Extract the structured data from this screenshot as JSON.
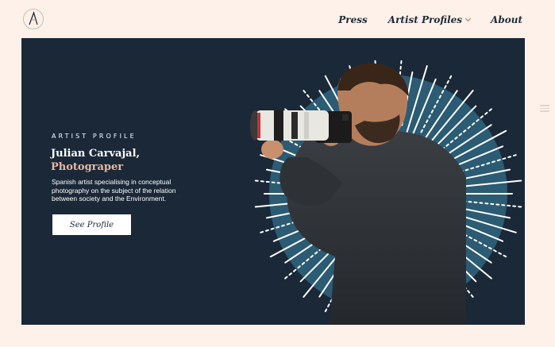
{
  "brand": {
    "logo_letter": "A"
  },
  "nav": {
    "items": [
      {
        "label": "Press"
      },
      {
        "label": "Artist Profiles"
      },
      {
        "label": "About"
      }
    ]
  },
  "hero": {
    "kicker": "ARTIST PROFILE",
    "name": "Julian Carvajal,",
    "role": "Photograper",
    "description": "Spanish artist specialising in conceptual photography on the subject of the relation between society and the Environment.",
    "cta_label": "See Profile",
    "image_subject": "photographer-with-camera",
    "background_color": "#1a2838",
    "accent_color": "#e4b9a5",
    "circle_color": "#2c5b74"
  }
}
